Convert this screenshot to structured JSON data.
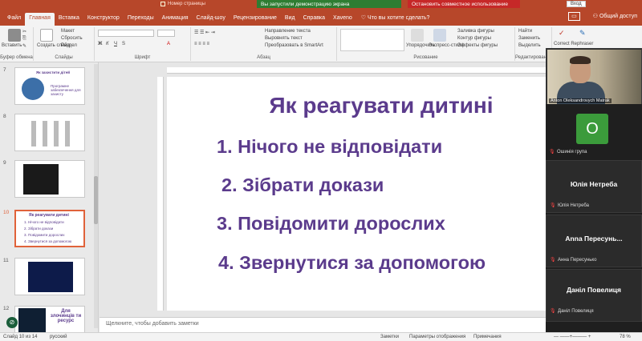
{
  "window": {
    "banner_demo": "Вы запустили демонстрацию экрана",
    "banner_share": "Остановить совместное использование",
    "entry_button": "Вход",
    "number_pages": "Номер страницы"
  },
  "ribbon_tabs": [
    "Файл",
    "Главная",
    "Вставка",
    "Конструктор",
    "Переходы",
    "Анимация",
    "Слайд-шоу",
    "Рецензирование",
    "Вид",
    "Справка",
    "Xaveno"
  ],
  "active_tab_index": 1,
  "search_label": "Что вы хотите сделать?",
  "share_label": "Общий доступ",
  "ribbon": {
    "paste": "Вставить",
    "create_slide": "Создать слайд",
    "layout": "Макет",
    "reset": "Сбросить",
    "section": "Раздел",
    "clipboard": "Буфер обмена",
    "slides": "Слайды",
    "font": "Шрифт",
    "paragraph": "Абзац",
    "drawing": "Рисование",
    "editing": "Редактирование",
    "text_direction": "Направление текста",
    "align_text": "Выровнять текст",
    "smartart": "Преобразовать в SmartArt",
    "arrange": "Упорядочить",
    "quick_styles": "Экспресс-стили",
    "shape_fill": "Заливка фигуры",
    "shape_outline": "Контур фигуры",
    "shape_effects": "Эффекты фигуры",
    "find": "Найти",
    "replace": "Заменить",
    "select": "Выделить",
    "correct": "Correct",
    "rephraser": "Correct Rephraser"
  },
  "thumbnails": [
    {
      "num": "7",
      "title": "Як захистити дітей",
      "text": "Програмне забезпечення для захисту"
    },
    {
      "num": "8",
      "title": "",
      "text": ""
    },
    {
      "num": "9",
      "title": "",
      "text": ""
    },
    {
      "num": "10",
      "title": "Як реагувати дитині",
      "lines": [
        "1. Нічого не відповідати",
        "2. Зібрати докази",
        "3. Повідомити дорослих",
        "4. Звернутися за допомогою"
      ]
    },
    {
      "num": "11",
      "title": "",
      "text": ""
    },
    {
      "num": "12",
      "title": "Для злочинців ти ресурс",
      "text": ""
    }
  ],
  "slide": {
    "title": "Як реагувати дитині",
    "items": [
      "1. Нічого не відповідати",
      "2. Зібрати докази",
      "3. Повідомити дорослих",
      "4. Звернутися за допомогою"
    ]
  },
  "notes_placeholder": "Щелкните, чтобы добавить заметки",
  "status": {
    "slide_info": "Слайд 10 из 14",
    "language": "русский",
    "notes": "Заметки",
    "display": "Параметры отображения",
    "comments": "Примечания",
    "zoom": "78 %"
  },
  "meeting": {
    "video_name": "Anton Oleksandrovych Matrak",
    "participants": [
      {
        "avatar": "O",
        "small": "Ошинія група"
      },
      {
        "big": "Юлія Нетреба",
        "small": "Юлія Нетреба"
      },
      {
        "big": "Anna  Пересунь...",
        "small": "Анна Пересунько"
      },
      {
        "big": "Даніл Повелиця",
        "small": "Даніл Повелиця"
      }
    ]
  },
  "colors": {
    "accent": "#b7472a",
    "slide_text": "#5b3b8c",
    "banner_green": "#2e7d32",
    "banner_red": "#c62828"
  }
}
